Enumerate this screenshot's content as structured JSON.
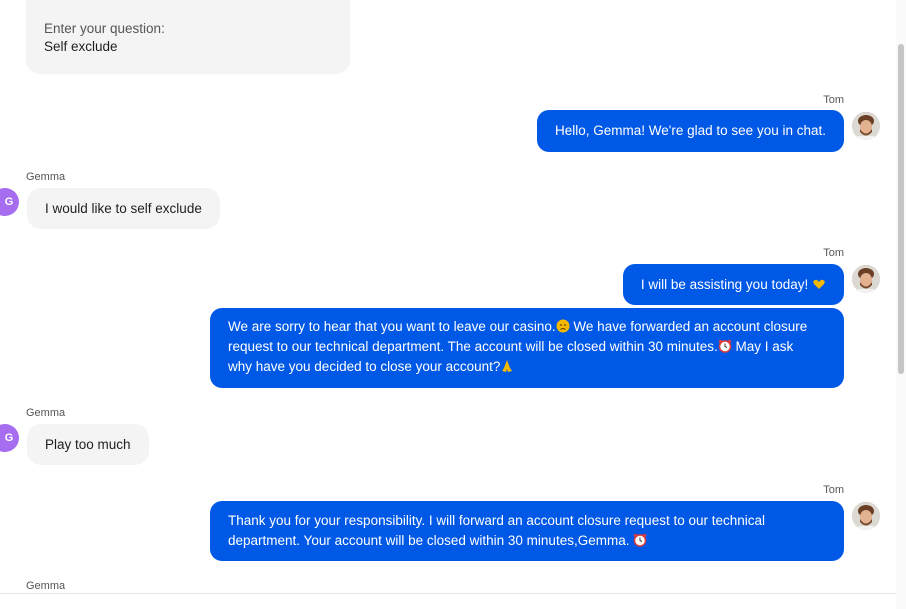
{
  "form": {
    "question_label": "Enter your question:",
    "question_value": "Self exclude"
  },
  "agent": {
    "name": "Tom"
  },
  "user": {
    "name": "Gemma",
    "initial": "G"
  },
  "messages": [
    {
      "from": "agent",
      "text": "Hello, Gemma! We're glad to see you in chat."
    },
    {
      "from": "user",
      "text": "I would like to self exclude"
    },
    {
      "from": "agent",
      "text": "I will be assisting you today!"
    },
    {
      "from": "agent",
      "line1": "We are sorry to hear that you want to leave our casino.",
      "line1b": " We have forwarded an account closure",
      "line2": "request to our technical department. The account will be closed within 30 minutes.",
      "line2b": " May I ask",
      "line3": "why have you decided to close your account?"
    },
    {
      "from": "user",
      "text": "Play too much"
    },
    {
      "from": "agent",
      "line1": "Thank you for your responsibility. I will forward an account closure request to our technical",
      "line2": "department. Your account will be closed within 30 minutes,Gemma. "
    }
  ],
  "colors": {
    "agent_bubble": "#0058e6",
    "user_bubble": "#f4f4f5",
    "user_avatar": "#a66df0"
  }
}
